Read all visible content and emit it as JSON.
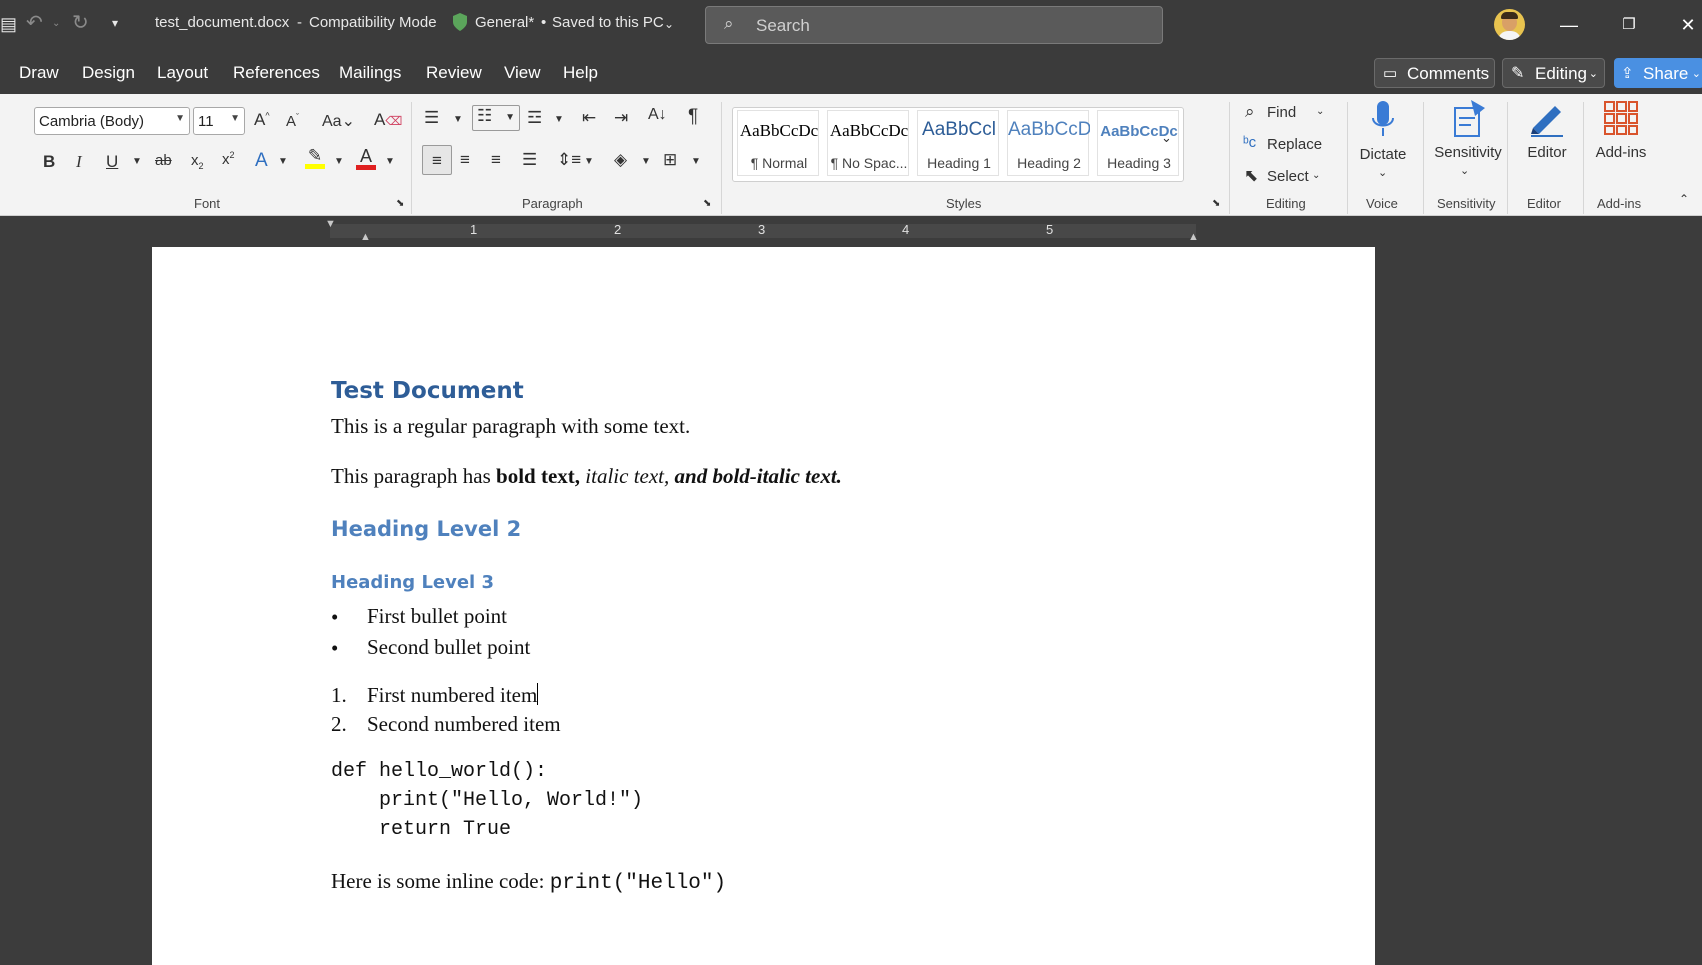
{
  "titlebar": {
    "filename": "test_document.docx",
    "separator": "-",
    "mode": "Compatibility Mode",
    "label": "General*",
    "bullet": "•",
    "save_state": "Saved to this PC",
    "search_placeholder": "Search"
  },
  "menu": [
    "Draw",
    "Design",
    "Layout",
    "References",
    "Mailings",
    "Review",
    "View",
    "Help"
  ],
  "actions": {
    "comments": "Comments",
    "editing": "Editing",
    "share": "Share"
  },
  "ribbon": {
    "font_name": "Cambria (Body)",
    "font_size": "11",
    "groups": {
      "font": "Font",
      "paragraph": "Paragraph",
      "styles": "Styles",
      "editing": "Editing",
      "voice": "Voice",
      "sensitivity": "Sensitivity",
      "editor": "Editor",
      "addins": "Add-ins"
    },
    "styles": [
      {
        "sample": "AaBbCcDc",
        "name": "¶ Normal"
      },
      {
        "sample": "AaBbCcDc",
        "name": "¶ No Spac..."
      },
      {
        "sample": "AaBbCcl",
        "name": "Heading 1"
      },
      {
        "sample": "AaBbCcD",
        "name": "Heading 2"
      },
      {
        "sample": "AaBbCcDc",
        "name": "Heading 3"
      }
    ],
    "find": "Find",
    "replace": "Replace",
    "select": "Select",
    "dictate": "Dictate",
    "sensitivity": "Sensitivity",
    "editor": "Editor",
    "addins": "Add-ins",
    "icons": [
      "bold-icon",
      "italic-icon",
      "underline-icon",
      "strikethrough-icon",
      "subscript-icon",
      "superscript-icon",
      "text-effects-icon",
      "highlight-icon",
      "font-color-icon",
      "bullets-icon",
      "numbering-icon",
      "multilevel-list-icon",
      "decrease-indent-icon",
      "increase-indent-icon",
      "sort-icon",
      "show-formatting-icon",
      "align-left-icon",
      "center-icon",
      "align-right-icon",
      "justify-icon",
      "line-spacing-icon",
      "shading-icon",
      "borders-icon",
      "microphone-icon"
    ]
  },
  "ruler": {
    "numbers": [
      "1",
      "2",
      "3",
      "4",
      "5"
    ]
  },
  "document": {
    "title": "Test Document",
    "para1": "This is a regular paragraph with some text.",
    "para2_pre": "This paragraph has ",
    "para2_bold": "bold text,",
    "para2_italic": " italic text,",
    "para2_bolditalic": " and bold-italic text.",
    "heading2": "Heading Level 2",
    "heading3": "Heading Level 3",
    "bullets": [
      "First bullet point",
      "Second bullet point"
    ],
    "bullet_mark": "•",
    "numbered": [
      {
        "n": "1.",
        "text": "First numbered item"
      },
      {
        "n": "2.",
        "text": "Second numbered item"
      }
    ],
    "code_lines": [
      "def hello_world():",
      "    print(\"Hello, World!\")",
      "    return True"
    ],
    "inline_pre": "Here is some inline code: ",
    "inline_code": "print(\"Hello\")"
  },
  "colors": {
    "heading1": "#2e5d97",
    "heading2": "#4f81bd",
    "share": "#4a90e2",
    "ribbon_bg": "#f3f3f3",
    "chrome_bg": "#3b3b3b"
  }
}
